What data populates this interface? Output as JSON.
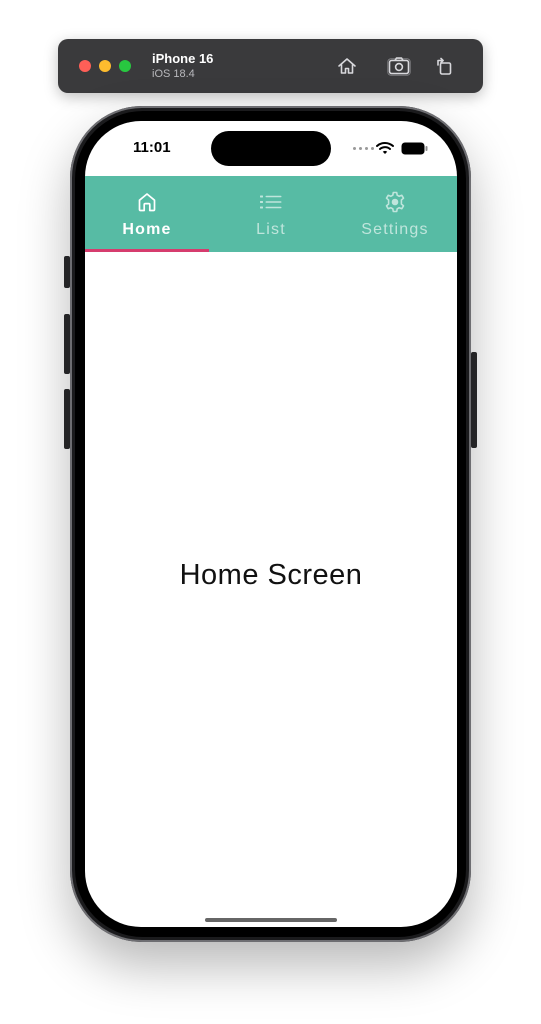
{
  "simulator": {
    "device_name": "iPhone 16",
    "os_version": "iOS 18.4",
    "toolbar_icons": [
      "home-icon",
      "screenshot-icon",
      "rotate-icon"
    ]
  },
  "status_bar": {
    "time": "11:01",
    "icons": [
      "signal-icon",
      "wifi-icon",
      "battery-icon"
    ]
  },
  "tab_bar": {
    "background_color": "#57bba4",
    "indicator_color": "#d63c6e",
    "tabs": [
      {
        "label": "Home",
        "icon": "home-icon",
        "active": true
      },
      {
        "label": "List",
        "icon": "list-icon",
        "active": false
      },
      {
        "label": "Settings",
        "icon": "gear-icon",
        "active": false
      }
    ]
  },
  "content": {
    "text": "Home Screen"
  }
}
